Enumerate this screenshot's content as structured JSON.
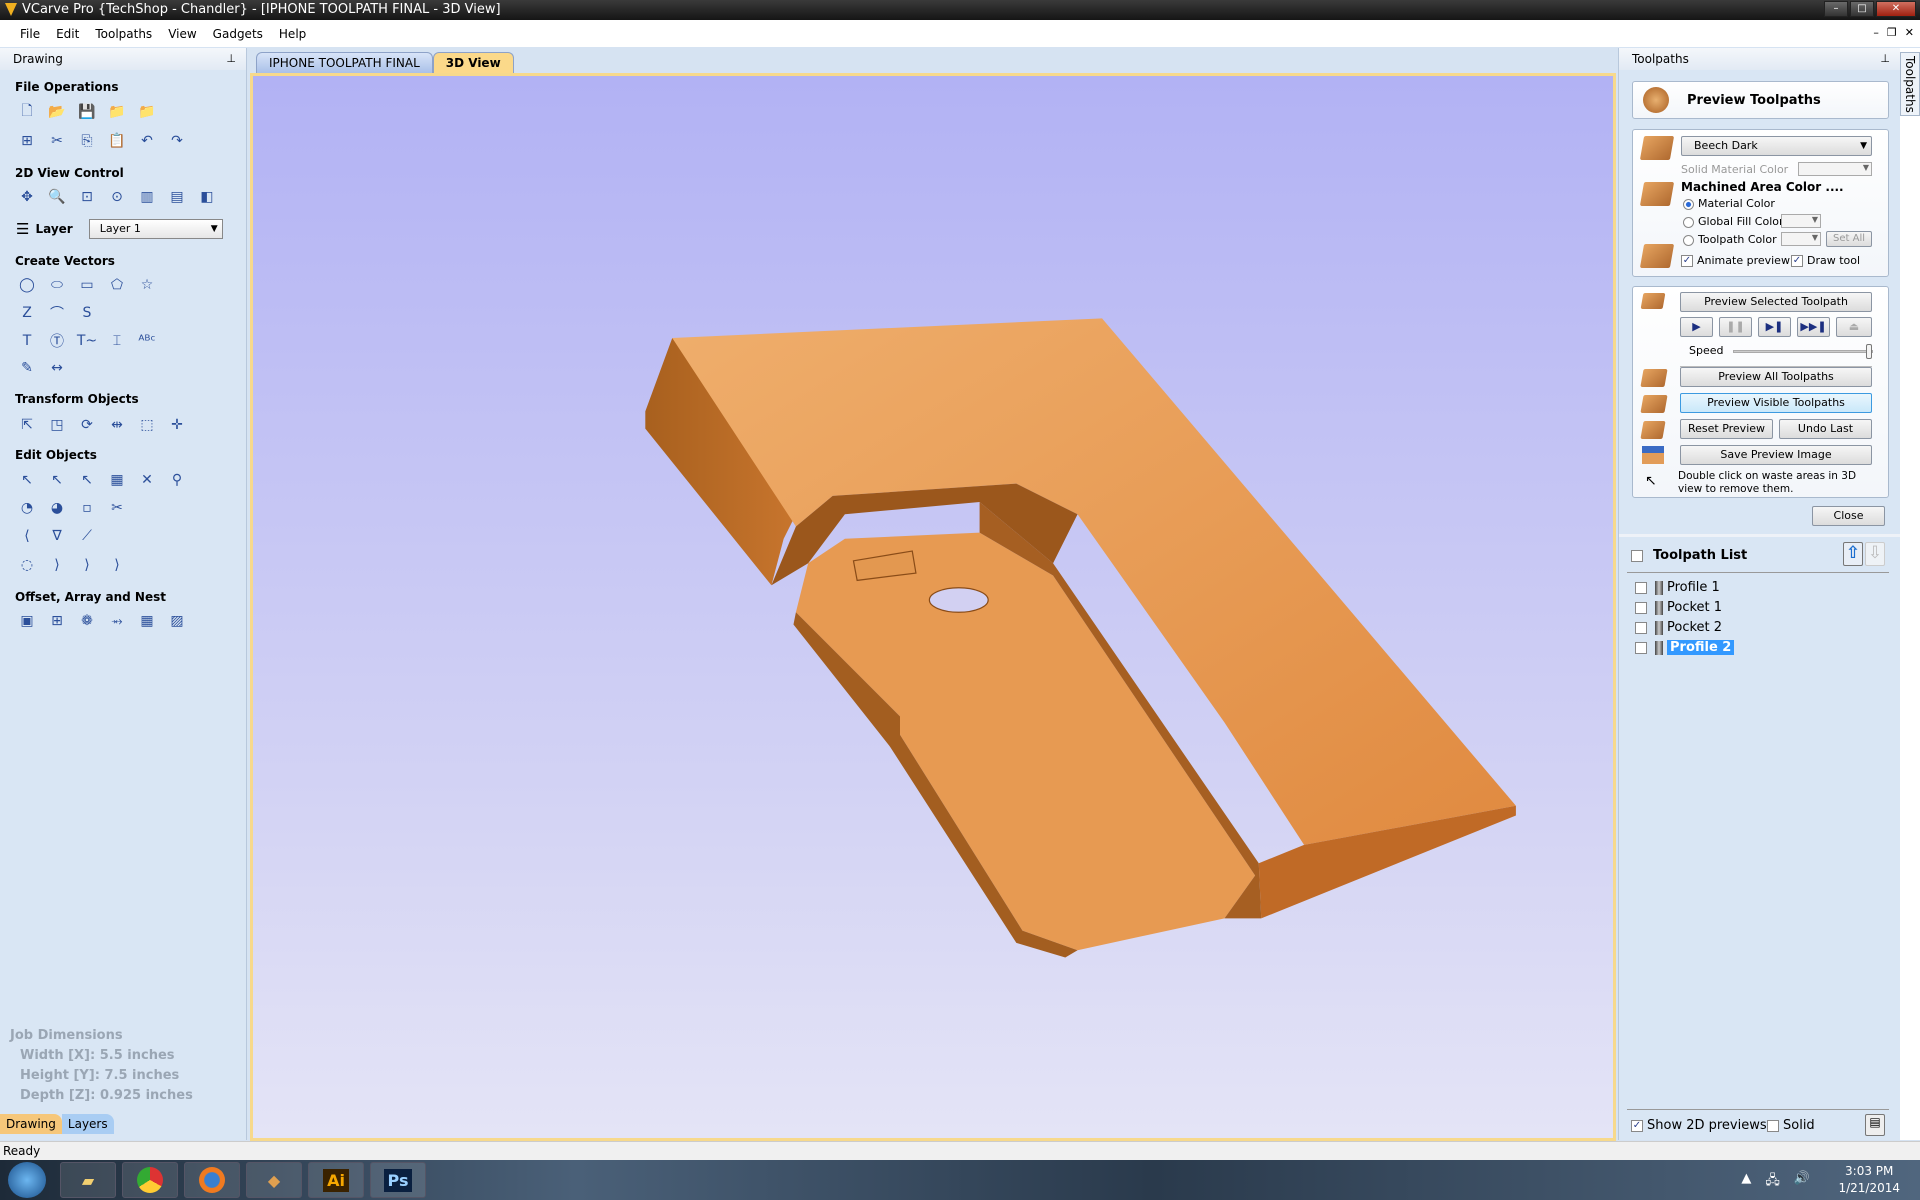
{
  "window": {
    "title": "VCarve Pro {TechShop - Chandler} - [IPHONE TOOLPATH FINAL - 3D View]"
  },
  "menu": [
    "File",
    "Edit",
    "Toolpaths",
    "View",
    "Gadgets",
    "Help"
  ],
  "left_panel": {
    "title": "Drawing",
    "sections": {
      "file_operations": "File Operations",
      "view_control": "2D View Control",
      "create_vectors": "Create Vectors",
      "transform_objects": "Transform Objects",
      "edit_objects": "Edit Objects",
      "offset_array_nest": "Offset, Array and Nest"
    },
    "layer_label": "Layer",
    "layer_value": "Layer 1",
    "job_dimensions": {
      "title": "Job Dimensions",
      "width": "Width  [X]: 5.5 inches",
      "height": "Height [Y]: 7.5 inches",
      "depth": "Depth  [Z]: 0.925 inches"
    },
    "tabs": [
      "Drawing",
      "Layers"
    ]
  },
  "doc_tabs": [
    "IPHONE TOOLPATH FINAL",
    "3D View"
  ],
  "active_doc_tab": "3D View",
  "right_panel": {
    "title": "Toolpaths",
    "side_tab": "Toolpaths",
    "preview_title": "Preview Toolpaths",
    "material": "Beech Dark",
    "solid_material_color": "Solid Material Color",
    "machined_area_color": "Machined Area Color ....",
    "radio_options": [
      "Material Color",
      "Global Fill Color",
      "Toolpath Color"
    ],
    "radio_selected": "Material Color",
    "set_all": "Set All",
    "animate_preview": {
      "label": "Animate preview",
      "checked": true
    },
    "draw_tool": {
      "label": "Draw tool",
      "checked": true
    },
    "preview_selected": "Preview Selected Toolpath",
    "speed_label": "Speed",
    "speed_level": 1.0,
    "preview_all": "Preview All Toolpaths",
    "preview_visible": "Preview Visible Toolpaths",
    "reset_preview": "Reset Preview",
    "undo_last": "Undo Last",
    "save_preview_image": "Save Preview Image",
    "hint": "Double click on waste areas in 3D view to remove them.",
    "close": "Close",
    "toolpath_list_title": "Toolpath List",
    "toolpaths": [
      {
        "name": "Profile 1",
        "checked": false,
        "selected": false
      },
      {
        "name": "Pocket 1",
        "checked": false,
        "selected": false
      },
      {
        "name": "Pocket 2",
        "checked": false,
        "selected": false
      },
      {
        "name": "Profile 2",
        "checked": false,
        "selected": true
      }
    ],
    "show_2d_previews": {
      "label": "Show 2D previews",
      "checked": true
    },
    "solid": {
      "label": "Solid",
      "checked": false
    }
  },
  "status": "Ready",
  "taskbar": {
    "time": "3:03 PM",
    "date": "1/21/2014",
    "apps": [
      "Ai",
      "Ps"
    ]
  },
  "colors": {
    "view_top": "#b2b2f4",
    "view_bottom": "#e4e4f6",
    "wood": "#e0944c",
    "tab_active": "#fbd98a",
    "selection": "#3399ff"
  }
}
